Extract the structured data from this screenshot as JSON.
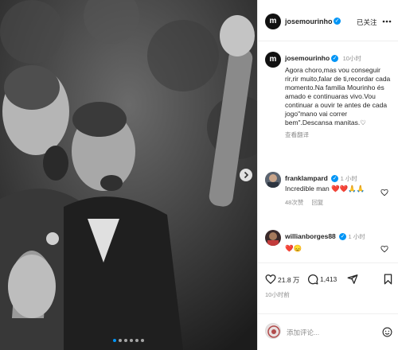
{
  "colors": {
    "accent": "#0095f6",
    "heart_red": "#ed4956",
    "text": "#262626",
    "muted": "#8e8e8e"
  },
  "post": {
    "username": "josemourinho",
    "follow_status": "已关注",
    "time": "10小时",
    "caption": "Agora choro,mas vou conseguir rir,rir muito,falar de ti,recordar cada momento.Na familia Mourinho és amado e continuaras vivo.Vou continuar a ouvir te antes de cada jogo\"mano vai correr bem\".Descansa manitas.♡",
    "see_translation": "查看翻译",
    "likes": "21.8 万",
    "comments_count": "1,413",
    "timestamp": "10小时前",
    "carousel_dots": 6
  },
  "comments": [
    {
      "username": "franklampard",
      "time": "1 小时",
      "text": "Incredible man ❤️❤️🙏🙏",
      "likes": "48次赞",
      "reply_label": "回复"
    },
    {
      "username": "willianborges88",
      "time": "1 小时",
      "text": "❤️😞"
    }
  ],
  "composer": {
    "placeholder": "添加评论..."
  },
  "icons": [
    "more-icon",
    "heart-icon",
    "comment-icon",
    "share-icon",
    "bookmark-icon",
    "emoji-icon",
    "next-arrow-icon"
  ]
}
